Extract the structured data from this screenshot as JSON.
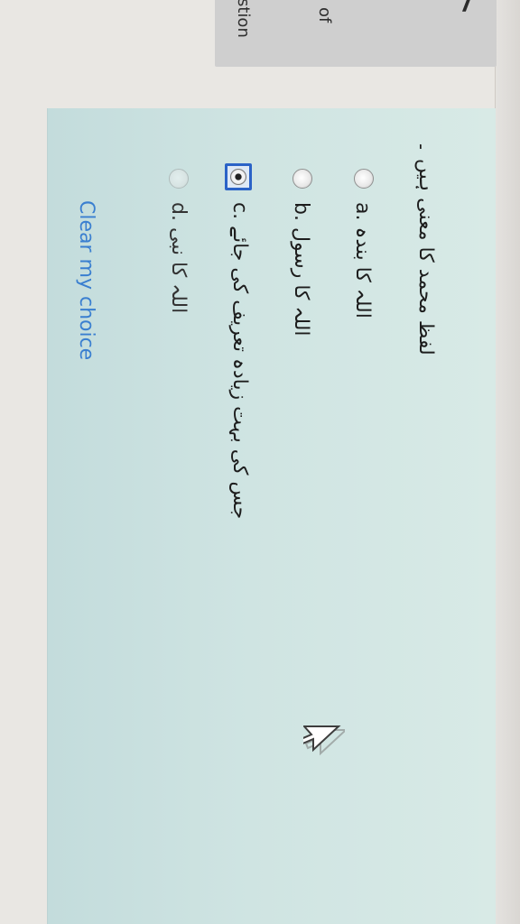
{
  "header": {
    "question_number": "7",
    "info_of": "of",
    "info_question": "stion"
  },
  "question": {
    "text": "لفظ محمد کا معنی ہیں ۔",
    "options": [
      {
        "label": "a. اللہ کا بندہ",
        "selected": false
      },
      {
        "label": "b. اللہ کا رسول",
        "selected": false
      },
      {
        "label": "c. جس کی بہت زیادہ تعریف کی جائے",
        "selected": true
      },
      {
        "label": "d. اللہ کا نبی",
        "selected": false
      }
    ],
    "clear_label": "Clear my choice"
  },
  "colors": {
    "content_bg": "#cfe4e2",
    "link": "#3a7fd0",
    "selected_border": "#2b63c7"
  },
  "icons": [
    "radio-button",
    "mouse-cursor-icon"
  ]
}
